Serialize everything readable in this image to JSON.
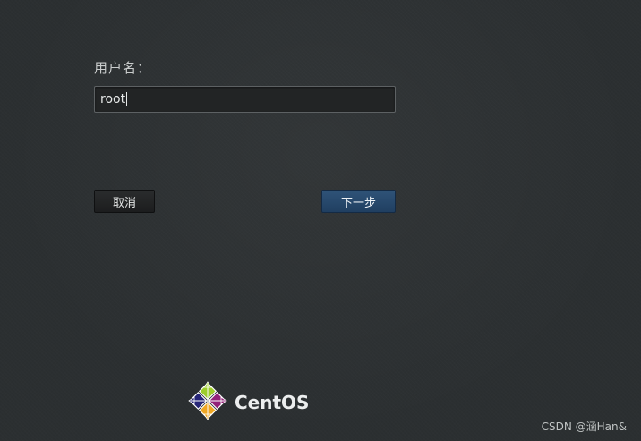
{
  "login": {
    "username_label": "用户名：",
    "username_value": "root",
    "cancel_label": "取消",
    "next_label": "下一步"
  },
  "brand": {
    "logo_icon": "centos-logo-icon",
    "name": "CentOS"
  },
  "watermark": {
    "text": "CSDN @涵Han&"
  },
  "colors": {
    "background": "#2b2f31",
    "next_button": "#2a4a6e",
    "logo_green": "#9ccd2a",
    "logo_purple": "#932279",
    "logo_orange": "#efa724",
    "logo_blue": "#262577"
  }
}
